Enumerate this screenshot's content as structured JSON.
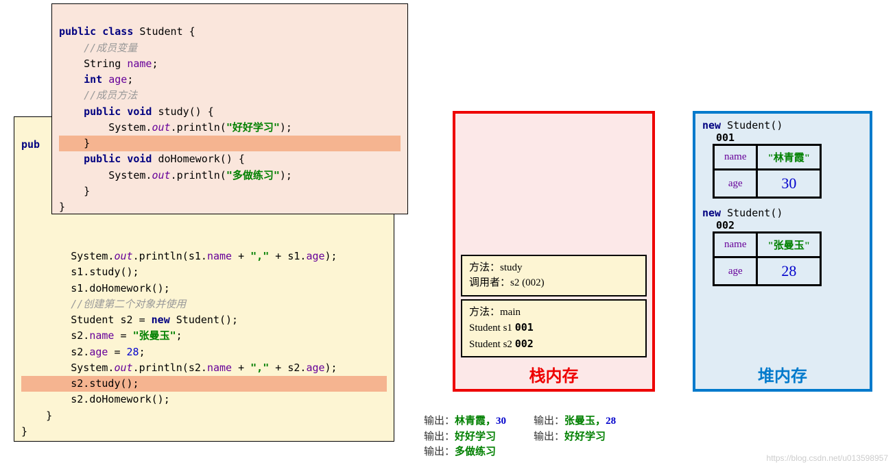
{
  "code_front": {
    "l1_pre": "public class ",
    "l1_post": "Student {",
    "l2": "    //成员变量",
    "l3_type": "    String ",
    "l3_name": "name",
    "l3_end": ";",
    "l4_kw": "    int ",
    "l4_name": "age",
    "l4_end": ";",
    "l5": "    //成员方法",
    "l6_kw": "    public void ",
    "l6_rest": "study() {",
    "l7_pre": "        System.",
    "l7_out": "out",
    "l7_mid": ".println(",
    "l7_str": "\"好好学习\"",
    "l7_end": ");",
    "l8": "    }",
    "l9_kw": "    public void ",
    "l9_rest": "doHomework() {",
    "l10_pre": "        System.",
    "l10_out": "out",
    "l10_mid": ".println(",
    "l10_str": "\"多做练习\"",
    "l10_end": ");",
    "l11": "    }",
    "l12": "}"
  },
  "code_back": {
    "l1": "pub",
    "l2_pre": "        System.",
    "l2_out": "out",
    "l2_mid": ".println(s1.",
    "l2_n": "name",
    "l2_m2": " + ",
    "l2_str": "\",\"",
    "l2_m3": " + s1.",
    "l2_a": "age",
    "l2_end": ");",
    "l3": "        s1.study();",
    "l4": "        s1.doHomework();",
    "l5": "        //创建第二个对象并使用",
    "l6_pre": "        Student s2 = ",
    "l6_kw": "new ",
    "l6_post": "Student();",
    "l7_pre": "        s2.",
    "l7_n": "name",
    "l7_eq": " = ",
    "l7_str": "\"张曼玉\"",
    "l7_end": ";",
    "l8_pre": "        s2.",
    "l8_a": "age",
    "l8_eq": " = ",
    "l8_num": "28",
    "l8_end": ";",
    "l9_pre": "        System.",
    "l9_out": "out",
    "l9_mid": ".println(s2.",
    "l9_n": "name",
    "l9_m2": " + ",
    "l9_str": "\",\"",
    "l9_m3": " + s2.",
    "l9_a": "age",
    "l9_end": ");",
    "l10": "        s2.study();",
    "l11": "        s2.doHomework();",
    "l12": "    }",
    "l13": "}"
  },
  "stack": {
    "title": "栈内存",
    "frame1_l1": "方法：study",
    "frame1_l2": "调用者：s2 (002)",
    "frame2_l1": "方法：main",
    "frame2_l2a": " Student s1    ",
    "frame2_l2b": "001",
    "frame2_l3a": " Student s2    ",
    "frame2_l3b": "002"
  },
  "heap": {
    "title": "堆内存",
    "obj1": {
      "kw": "new ",
      "type": "Student()",
      "id": "001",
      "name_field": "name",
      "name_val": "\"林青霞\"",
      "age_field": "age",
      "age_val": "30"
    },
    "obj2": {
      "kw": "new ",
      "type": "Student()",
      "id": "002",
      "name_field": "name",
      "name_val": "\"张曼玉\"",
      "age_field": "age",
      "age_val": "28"
    }
  },
  "output": {
    "label": "输出：",
    "col1_l1_str": "林青霞，",
    "col1_l1_num": "30",
    "col1_l2": "好好学习",
    "col1_l3": "多做练习",
    "col2_l1_str": "张曼玉，",
    "col2_l1_num": "28",
    "col2_l2": "好好学习"
  },
  "watermark": "https://blog.csdn.net/u013598957"
}
